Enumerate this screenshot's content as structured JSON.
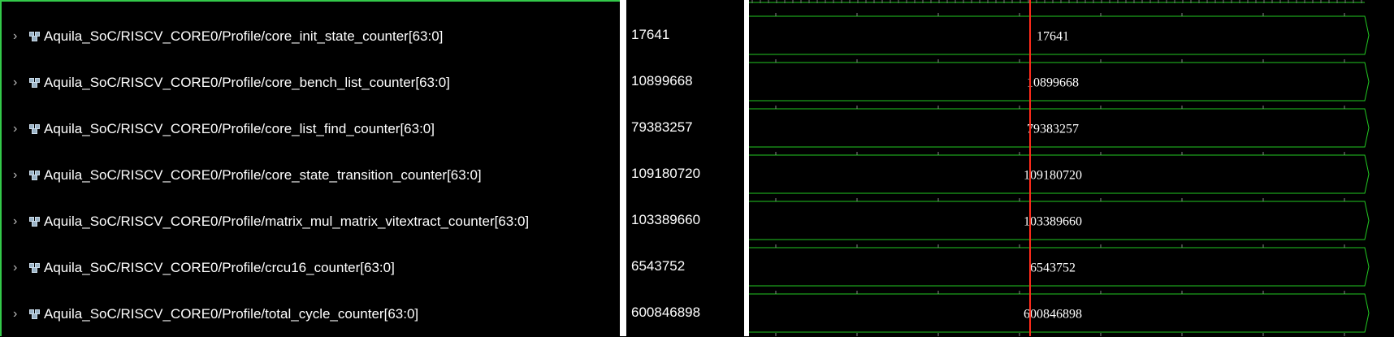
{
  "signals": [
    {
      "name": "Aquila_SoC/RISCV_CORE0/Profile/core_init_state_counter[63:0]",
      "value": "17641"
    },
    {
      "name": "Aquila_SoC/RISCV_CORE0/Profile/core_bench_list_counter[63:0]",
      "value": "10899668"
    },
    {
      "name": "Aquila_SoC/RISCV_CORE0/Profile/core_list_find_counter[63:0]",
      "value": "79383257"
    },
    {
      "name": "Aquila_SoC/RISCV_CORE0/Profile/core_state_transition_counter[63:0]",
      "value": "109180720"
    },
    {
      "name": "Aquila_SoC/RISCV_CORE0/Profile/matrix_mul_matrix_vitextract_counter[63:0]",
      "value": "103389660"
    },
    {
      "name": "Aquila_SoC/RISCV_CORE0/Profile/crcu16_counter[63:0]",
      "value": "6543752"
    },
    {
      "name": "Aquila_SoC/RISCV_CORE0/Profile/total_cycle_counter[63:0]",
      "value": "600846898"
    }
  ],
  "colors": {
    "waveform": "#22c922",
    "cursor": "#ff2a1a",
    "pane_border": "#33c94a",
    "text": "#ffffff"
  },
  "icons": {
    "expand": "chevron-right-icon",
    "bus": "bus-signal-icon"
  }
}
